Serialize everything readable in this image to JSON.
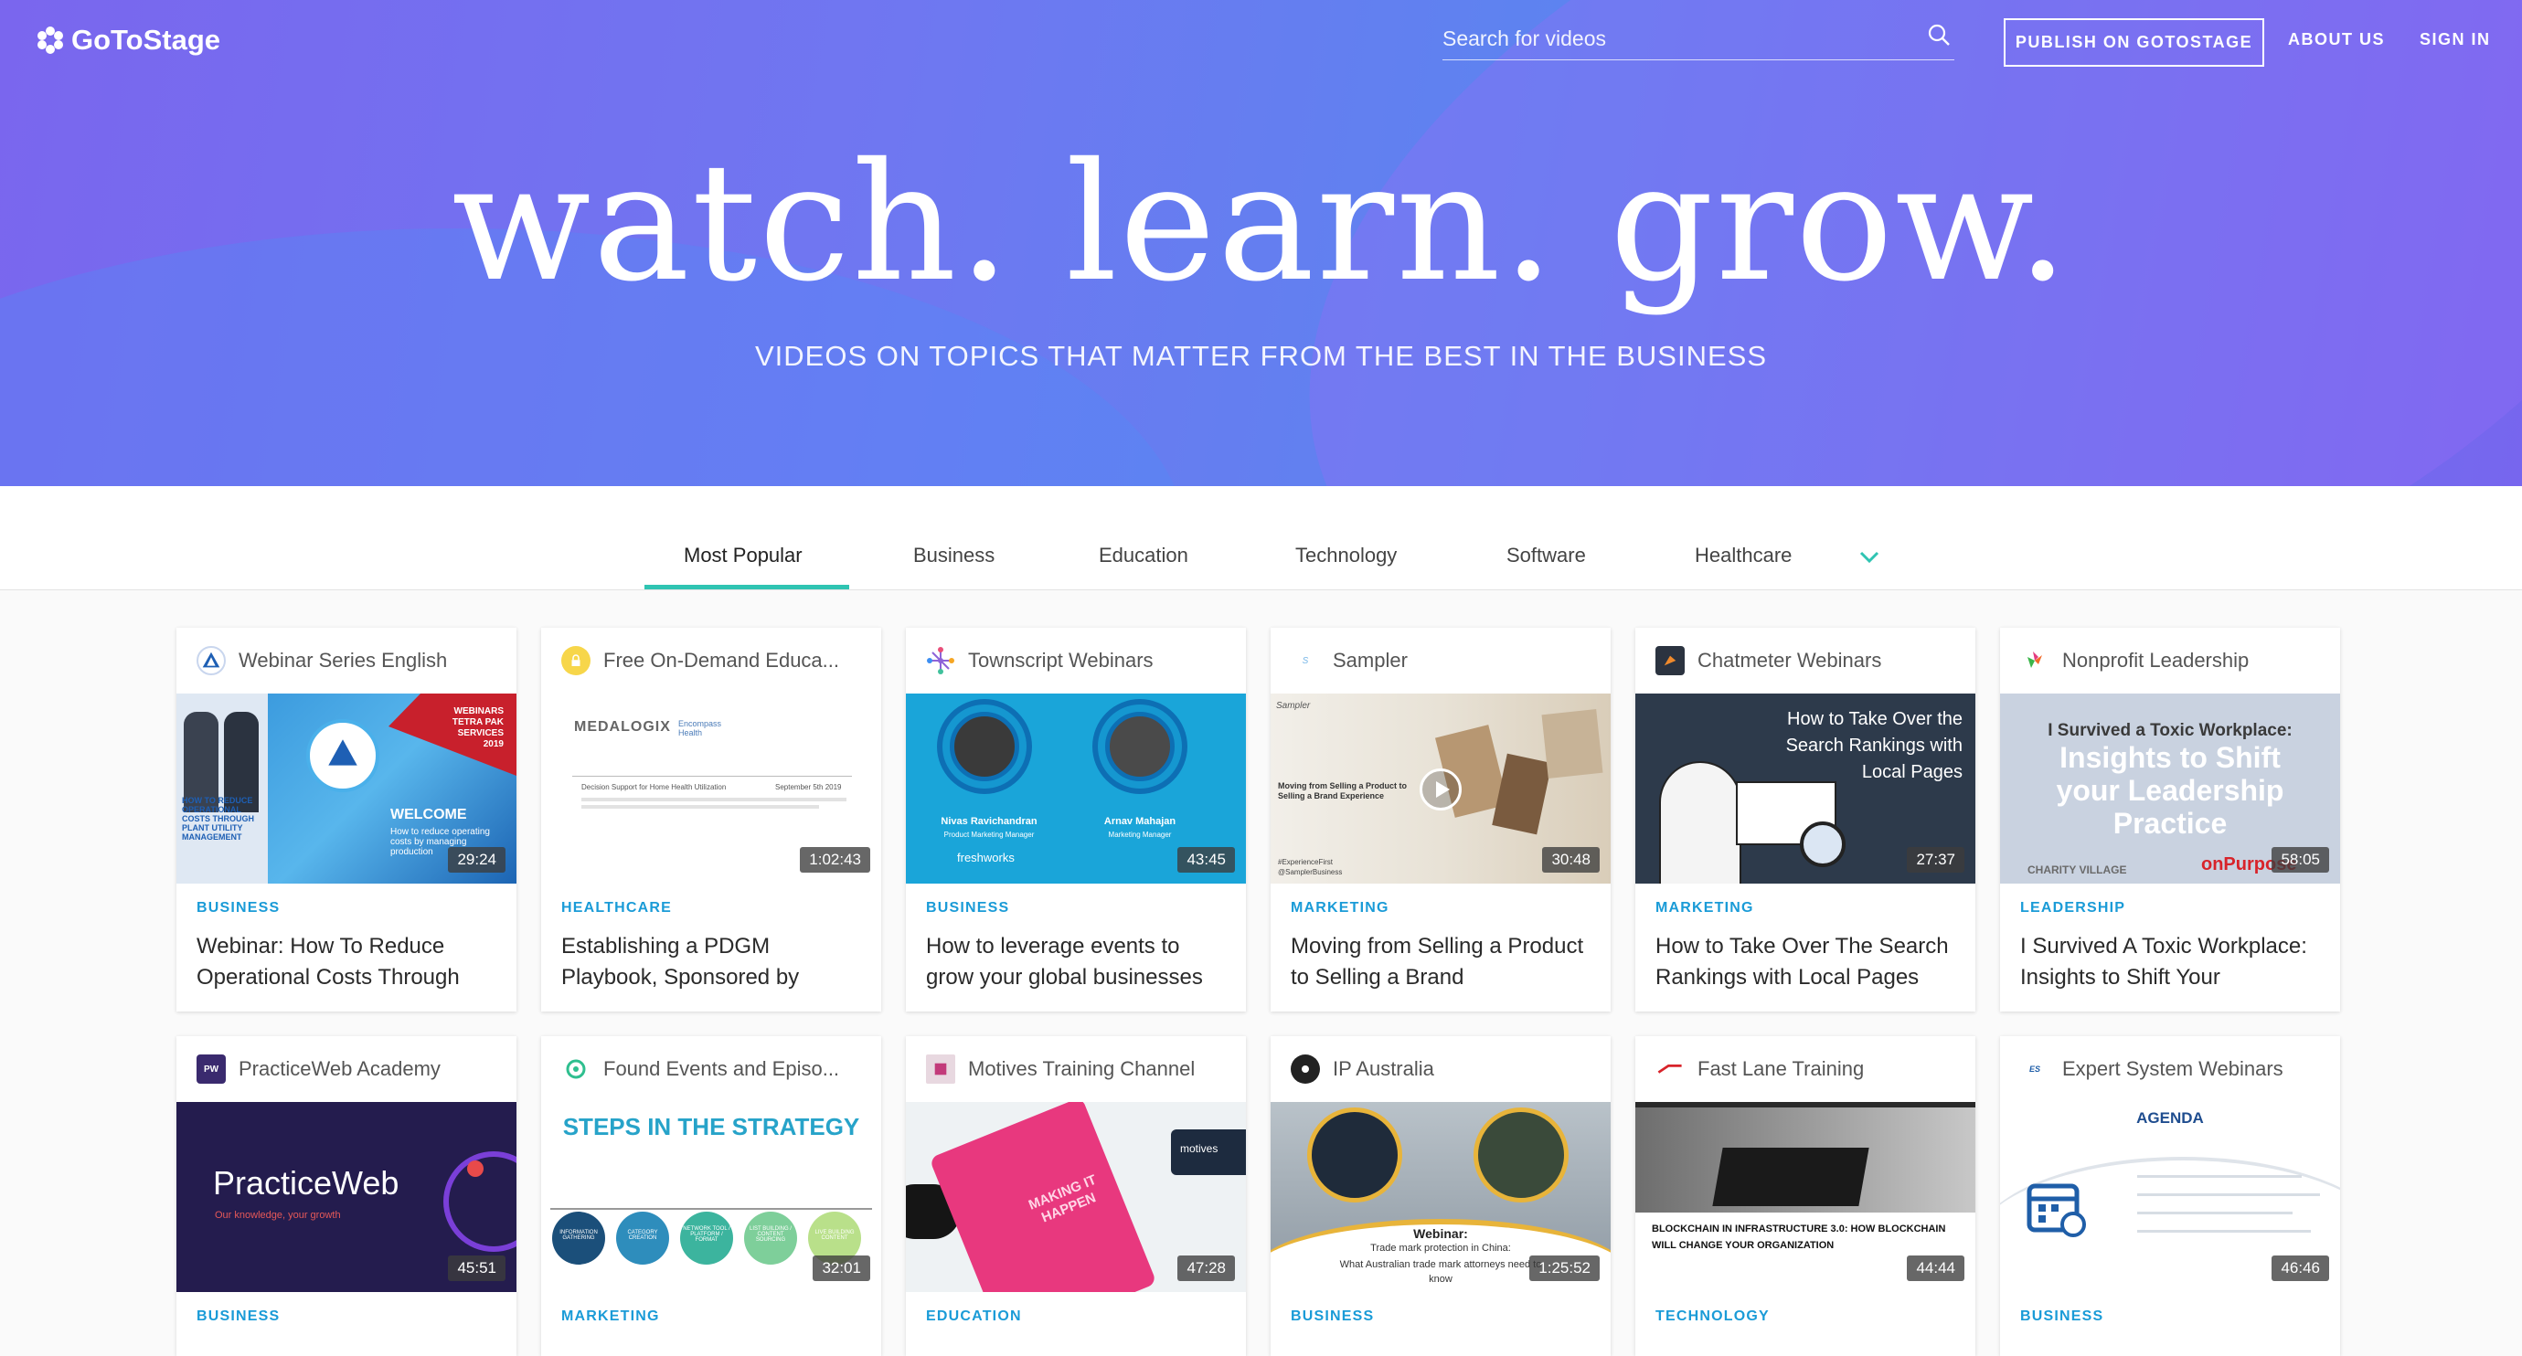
{
  "header": {
    "logo_text": "GoToStage",
    "search_placeholder": "Search for videos",
    "publish_label": "PUBLISH ON GOTOSTAGE",
    "about_label": "ABOUT US",
    "signin_label": "SIGN IN"
  },
  "hero": {
    "title": "watch. learn. grow.",
    "subtitle": "VIDEOS ON TOPICS THAT MATTER FROM THE BEST IN THE BUSINESS"
  },
  "tabs": [
    {
      "label": "Most Popular",
      "active": true
    },
    {
      "label": "Business"
    },
    {
      "label": "Education"
    },
    {
      "label": "Technology"
    },
    {
      "label": "Software"
    },
    {
      "label": "Healthcare"
    }
  ],
  "colors": {
    "accent": "#2fc4b2",
    "category": "#1a9bd7",
    "hero_start": "#7a66ee",
    "hero_end": "#5d83f0"
  },
  "cards": [
    {
      "channel": "Webinar Series English",
      "icon": "tetra-pak-icon",
      "duration": "29:24",
      "category": "BUSINESS",
      "title": "Webinar: How To Reduce Operational Costs Through",
      "thumb_texts": [
        "WEBINARS TETRA PAK SERVICES 2019",
        "WELCOME",
        "How to reduce operating costs by managing production",
        "HOW TO REDUCE OPERATIONAL COSTS THROUGH PLANT UTILITY MANAGEMENT"
      ]
    },
    {
      "channel": "Free On-Demand Educa...",
      "icon": "lock-icon",
      "duration": "1:02:43",
      "category": "HEALTHCARE",
      "title": "Establishing a PDGM Playbook, Sponsored by",
      "thumb_texts": [
        "MEDALOGIX",
        "Encompass Health",
        "Decision Support for Home Health Utilization",
        "September 5th 2019"
      ]
    },
    {
      "channel": "Townscript Webinars",
      "icon": "townscript-icon",
      "duration": "43:45",
      "category": "BUSINESS",
      "title": "How to leverage events to grow your global businesses",
      "thumb_texts": [
        "Nivas Ravichandran",
        "Product Marketing Manager",
        "Arnav Mahajan",
        "Marketing Manager",
        "freshworks"
      ]
    },
    {
      "channel": "Sampler",
      "icon": "sampler-icon",
      "duration": "30:48",
      "category": "MARKETING",
      "title": "Moving from Selling a Product to Selling a Brand",
      "thumb_texts": [
        "Sampler",
        "Moving from Selling a Product to Selling a Brand Experience",
        "#ExperienceFirst",
        "@SamplerBusiness"
      ]
    },
    {
      "channel": "Chatmeter Webinars",
      "icon": "chatmeter-icon",
      "duration": "27:37",
      "category": "MARKETING",
      "title": "How to Take Over The Search Rankings with Local Pages",
      "thumb_texts": [
        "How to Take Over the Search Rankings with Local Pages"
      ]
    },
    {
      "channel": "Nonprofit Leadership",
      "icon": "nonprofit-icon",
      "duration": "58:05",
      "category": "LEADERSHIP",
      "title": "I Survived A Toxic Workplace: Insights to Shift Your",
      "thumb_texts": [
        "I Survived a Toxic Workplace:",
        "Insights to Shift your Leadership Practice",
        "CHARITY VILLAGE",
        "onPurpose"
      ]
    },
    {
      "channel": "PracticeWeb Academy",
      "icon": "practiceweb-icon",
      "duration": "45:51",
      "category": "BUSINESS",
      "title": "",
      "thumb_texts": [
        "PracticeWeb",
        "Our knowledge, your growth"
      ]
    },
    {
      "channel": "Found Events and Episo...",
      "icon": "found-events-icon",
      "duration": "32:01",
      "category": "MARKETING",
      "title": "",
      "thumb_texts": [
        "STEPS IN THE STRATEGY",
        "INFORMATION GATHERING",
        "CATEGORY CREATION",
        "NETWORK TOOL / PLATFORM / FORMAT",
        "LIST BUILDING / CONTENT SOURCING",
        "LIVE BUILDING CONTENT"
      ]
    },
    {
      "channel": "Motives Training Channel",
      "icon": "motives-icon",
      "duration": "47:28",
      "category": "EDUCATION",
      "title": "",
      "thumb_texts": [
        "MAKING IT HAPPEN",
        "motives"
      ]
    },
    {
      "channel": "IP Australia",
      "icon": "ip-australia-icon",
      "duration": "1:25:52",
      "category": "BUSINESS",
      "title": "",
      "thumb_texts": [
        "Webinar:",
        "Trade mark protection in China:",
        "What Australian trade mark attorneys need to know"
      ]
    },
    {
      "channel": "Fast Lane Training",
      "icon": "fast-lane-icon",
      "duration": "44:44",
      "category": "TECHNOLOGY",
      "title": "",
      "thumb_texts": [
        "BLOCKCHAIN IN INFRASTRUCTURE 3.0: HOW BLOCKCHAIN WILL CHANGE YOUR ORGANIZATION"
      ]
    },
    {
      "channel": "Expert System Webinars",
      "icon": "expert-system-icon",
      "duration": "46:46",
      "category": "BUSINESS",
      "title": "",
      "thumb_texts": [
        "AGENDA"
      ]
    }
  ]
}
